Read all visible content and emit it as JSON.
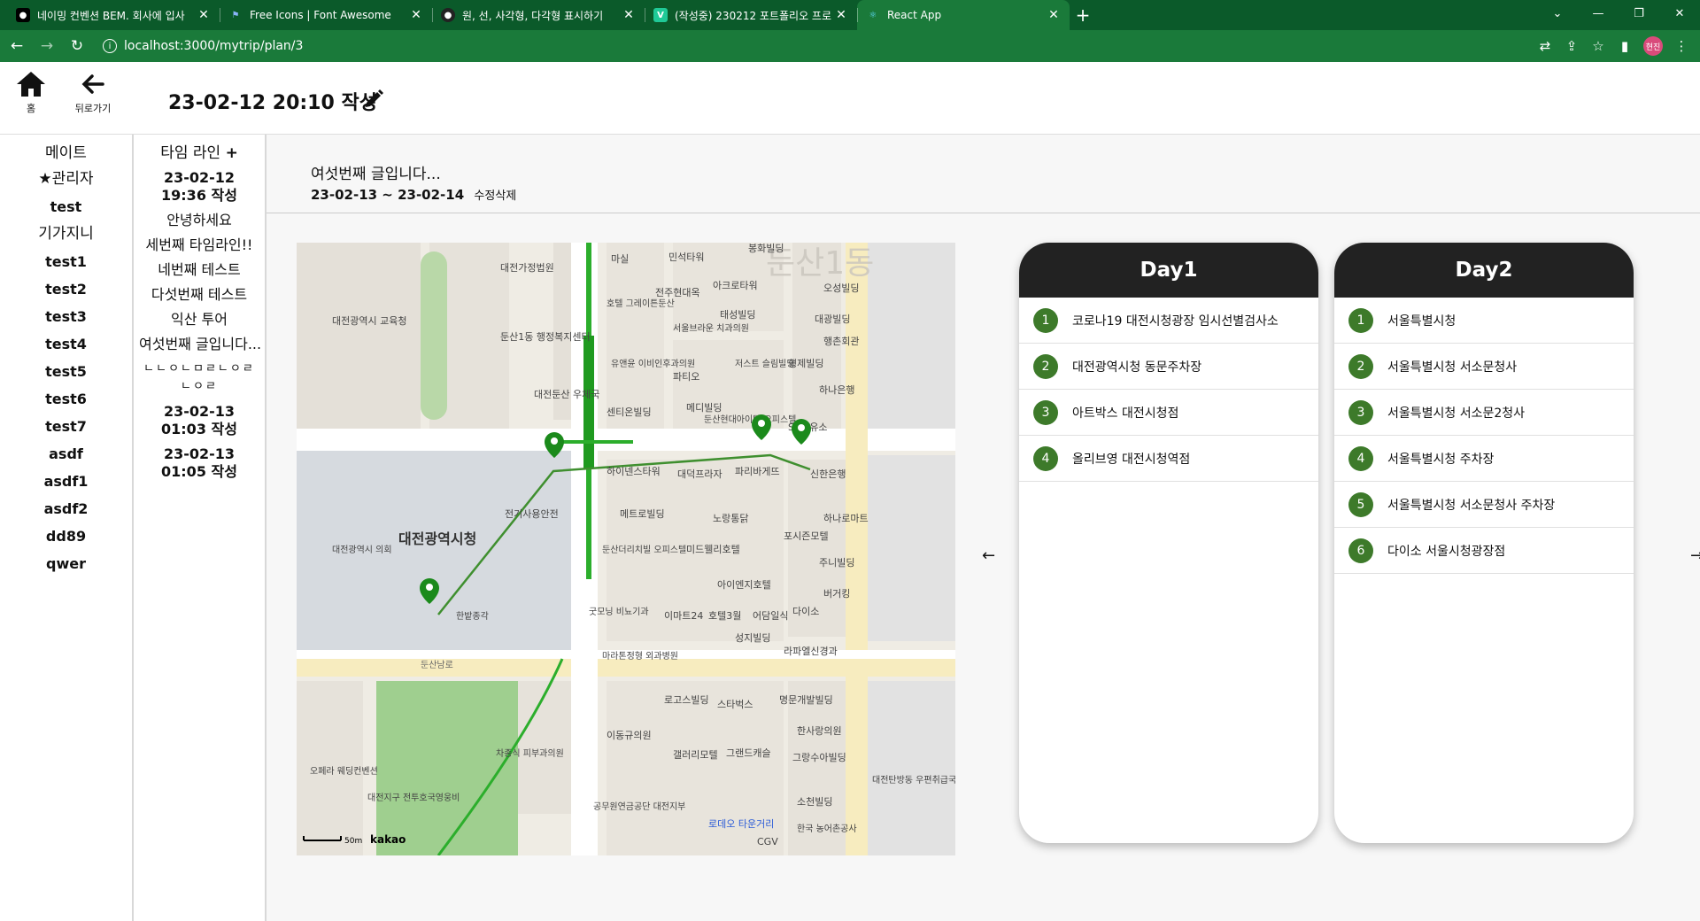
{
  "browser": {
    "tabs": [
      {
        "title": "네이밍 컨벤션 BEM. 회사에 입사",
        "active": false
      },
      {
        "title": "Free Icons | Font Awesome",
        "active": false
      },
      {
        "title": "원, 선, 사각형, 다각형 표시하기",
        "active": false
      },
      {
        "title": "(작성중) 230212 포트폴리오 프로",
        "active": false
      },
      {
        "title": "React App",
        "active": true
      }
    ],
    "url": "localhost:3000/mytrip/plan/3",
    "profile_label": "현진"
  },
  "header": {
    "home_label": "홈",
    "back_label": "뒤로가기",
    "written_at": "23-02-12 20:10 작성"
  },
  "mates": {
    "heading": "메이트",
    "items": [
      "관리자",
      "test",
      "기가지니",
      "test1",
      "test2",
      "test3",
      "test4",
      "test5",
      "test6",
      "test7",
      "asdf",
      "asdf1",
      "asdf2",
      "dd89",
      "qwer"
    ]
  },
  "timeline": {
    "heading": "타임 라인",
    "items": [
      "23-02-12 19:36 작성",
      "안녕하세요",
      "세번째 타임라인!!",
      "네번째 테스트",
      "다섯번째 테스트",
      "익산 투어",
      "여섯번째 글입니다...",
      "ㄴㄴㅇㄴㅁㄹㄴㅇㄹ ㄴㅇㄹ",
      "23-02-13 01:03 작성",
      "23-02-13 01:05 작성"
    ]
  },
  "plan": {
    "title": "여섯번째 글입니다...",
    "date_range": "23-02-13 ~ 23-02-14",
    "edit_label": "수정",
    "delete_label": "삭제"
  },
  "map": {
    "district_label": "둔산1동",
    "city_hall_label": "대전광역시청",
    "scale_label": "50m",
    "provider": "kakao",
    "road_label": "둔산남로",
    "labels": [
      "대전가정법원",
      "대전광역시 교육청",
      "둔산1동 행정복지센터",
      "대전둔산 우체국",
      "대전광역시 의회",
      "한밭종각",
      "전기사용안전",
      "센티온빌딩",
      "하이넨스타워",
      "대덕프라자",
      "파리바게뜨",
      "신한은행",
      "SK주유소",
      "노랑통닭",
      "메트로빌딩",
      "둔산더리치빌 오피스텔",
      "미드웰리호텔",
      "아이엔지호텔",
      "굿모닝 비뇨기과",
      "이마트24",
      "호텔3월",
      "어담일식",
      "다이소",
      "성지빌딩",
      "라파엘신경과",
      "마라톤정형 외과병원",
      "로고스빌딩",
      "스타벅스",
      "명문개발빌딩",
      "이동규의원",
      "갤러리모텔",
      "그랜드캐슬",
      "한사랑의원",
      "그랑수아빌딩",
      "차종식 피부과의원",
      "대전지구 전투호국영웅비",
      "오페라 웨딩컨벤션",
      "공무원연금공단 대전지부",
      "로데오 타운거리",
      "CGV",
      "한국 농어촌공사",
      "소천빌딩",
      "대전탄방동 우편취급국",
      "유앤윤 이비인후과의원",
      "서울브라운 치과의원",
      "파티오",
      "저스트 슬림빌딩",
      "형제빌딩",
      "하나은행",
      "대광빌딩",
      "행촌회관",
      "오성빌딩",
      "민석타워",
      "봉화빌딩",
      "마실",
      "호텔 그레이튼둔산",
      "태성빌딩",
      "전주현대옥",
      "아크로타워",
      "메디빌딩",
      "둔산현대아이텔 오피스텔",
      "하나로마트",
      "포시즌모텔",
      "주니빌딩",
      "버거킹"
    ],
    "markers": 4
  },
  "days": [
    {
      "title": "Day1",
      "places": [
        "코로나19 대전시청광장 임시선별검사소",
        "대전광역시청 동문주차장",
        "아트박스 대전시청점",
        "올리브영 대전시청역점"
      ]
    },
    {
      "title": "Day2",
      "places": [
        "서울특별시청",
        "서울특별시청 서소문청사",
        "서울특별시청 서소문2청사",
        "서울특별시청 주차장",
        "서울특별시청 서소문청사 주차장",
        "다이소 서울시청광장점"
      ]
    }
  ],
  "colors": {
    "browser_frame": "#0b5a2a",
    "browser_toolbar": "#1a7a3a",
    "marker": "#1b8a1b",
    "day_header": "#222222",
    "day_badge": "#3d7a2a"
  }
}
